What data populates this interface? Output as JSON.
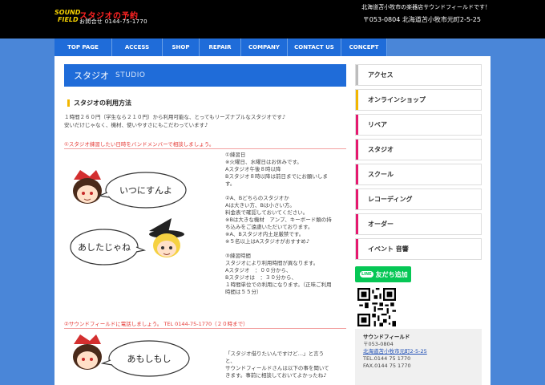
{
  "header": {
    "logo_line1": "SOUND",
    "logo_line2": "FIELD",
    "studio_reserve": "スタジオの予約",
    "phone": "お問合せ 0144-75-1770",
    "tagline": "北海道苫小牧市の楽器店サウンドフィールドです！",
    "address": "〒053-0804 北海道苫小牧市元町2-5-25"
  },
  "nav": [
    {
      "label": "TOP PAGE"
    },
    {
      "label": "ACCESS"
    },
    {
      "label": "SHOP"
    },
    {
      "label": "REPAIR"
    },
    {
      "label": "COMPANY"
    },
    {
      "label": "CONTACT US"
    },
    {
      "label": "CONCEPT"
    }
  ],
  "main": {
    "title": "スタジオ",
    "title_en": "STUDIO",
    "section_heading": "スタジオの利用方法",
    "intro_line1": "１時間２６０円（学生なら２１０円）から利用可能な、とってもリーズナブルなスタジオです♪",
    "intro_line2": "安いだけじゃなく、機材、使いやすさにもこだわっています♪",
    "step1": "①スタジオ練習したい日時をバンドメンバーで相談しましょう。",
    "step1_notes": [
      "①練習日",
      "※火曜日、水曜日はお休みです。",
      "Aスタジオ午後８時以降",
      "Bスタジオ８時以降は前日までにお願いします。",
      "",
      "②A、Bどちらのスタジオか",
      "Aは大きい方、Bは小さい方。",
      "料金表で確認しておいてください。",
      "※Bは大きな機材　アンプ、キーボード類の持ち込みをご遠慮いただいております。",
      "※A、Bスタジオ内土足厳禁です。",
      "※５名以上はAスタジオがおすすめ♪",
      "",
      "③練習時間",
      "スタジオにより利用時間が異なります。",
      "Aスタジオ　：００分から、",
      "Bスタジオは　：３０分から、",
      "１時間単位での利用になります。（正味ご利用時間は５５分）"
    ],
    "bubble1": "いつにすんよ",
    "bubble2": "あしたじゃね",
    "step2": "②サウンドフィールドに電話しましょう。 TEL 0144-75-1770（２０時まで）",
    "bubble3": "あもしもし",
    "step2_notes": [
      "「スタジオ借りたいんですけど…」と言うと、",
      "サウンドフィールドさんは以下の事を聞いてきます。事前に相談しておいてよかったね♪"
    ]
  },
  "sidebar": {
    "items": [
      {
        "label": "アクセス",
        "color": "#bdbdbd"
      },
      {
        "label": "オンラインショップ",
        "color": "#f2b600"
      },
      {
        "label": "リペア",
        "color": "#e5196f"
      },
      {
        "label": "スタジオ",
        "color": "#e5196f"
      },
      {
        "label": "スクール",
        "color": "#e5196f"
      },
      {
        "label": "レコーディング",
        "color": "#e5196f"
      },
      {
        "label": "オーダー",
        "color": "#e5196f"
      },
      {
        "label": "イベント 音響",
        "color": "#e5196f"
      }
    ],
    "line_badge": "LINE",
    "line_button": "友だち追加",
    "shop": {
      "name": "サウンドフィールド",
      "postal": "〒053-0804",
      "address": "北海道苫小牧市元町2-5-25",
      "tel": "TEL.0144 75 1770",
      "fax": "FAX.0144 75 1770"
    }
  }
}
